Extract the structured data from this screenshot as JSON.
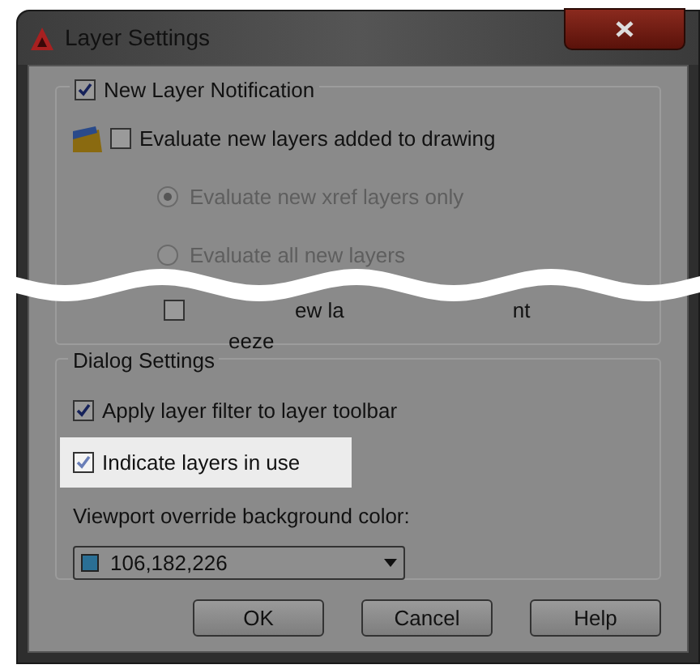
{
  "window": {
    "title": "Layer Settings"
  },
  "notification": {
    "label": "New Layer Notification",
    "checked": true,
    "evaluate": {
      "label": "Evaluate new layers added to drawing",
      "checked": false
    },
    "options": [
      {
        "label": "Evaluate new xref layers only",
        "selected": true,
        "disabled": true
      },
      {
        "label": "Evaluate all new layers",
        "selected": false,
        "disabled": true
      }
    ],
    "partial_row": {
      "checked": false,
      "fragments": [
        "ew la",
        "nt"
      ],
      "second_line": "eeze"
    }
  },
  "dialog_settings": {
    "label": "Dialog Settings",
    "options": [
      {
        "label": "Apply layer filter to layer toolbar",
        "checked": true,
        "highlighted": false
      },
      {
        "label": "Indicate layers in use",
        "checked": true,
        "highlighted": true
      }
    ],
    "color_label": "Viewport override background color:",
    "color": {
      "value": "106,182,226",
      "color": "#2a6f95"
    }
  },
  "buttons": [
    {
      "label": "OK"
    },
    {
      "label": "Cancel"
    },
    {
      "label": "Help"
    }
  ]
}
